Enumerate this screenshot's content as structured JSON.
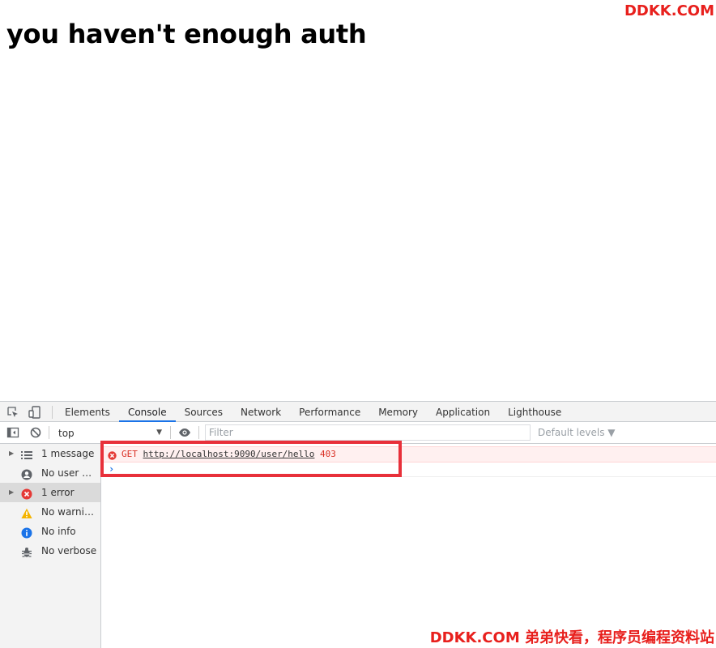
{
  "page": {
    "heading": "you haven't enough auth",
    "watermark_top": "DDKK.COM",
    "watermark_bottom": "DDKK.COM 弟弟快看，程序员编程资料站"
  },
  "devtools": {
    "tabs": [
      {
        "label": "Elements",
        "active": false
      },
      {
        "label": "Console",
        "active": true
      },
      {
        "label": "Sources",
        "active": false
      },
      {
        "label": "Network",
        "active": false
      },
      {
        "label": "Performance",
        "active": false
      },
      {
        "label": "Memory",
        "active": false
      },
      {
        "label": "Application",
        "active": false
      },
      {
        "label": "Lighthouse",
        "active": false
      }
    ],
    "toolbar": {
      "context": "top",
      "filter_placeholder": "Filter",
      "levels": "Default levels ▼"
    },
    "sidebar": {
      "items": [
        {
          "label": "1 message",
          "icon": "list-icon",
          "caret": true,
          "selected": false
        },
        {
          "label": "No user me...",
          "icon": "user-icon",
          "caret": false,
          "selected": false
        },
        {
          "label": "1 error",
          "icon": "error-icon",
          "caret": true,
          "selected": true
        },
        {
          "label": "No warnings",
          "icon": "warning-icon",
          "caret": false,
          "selected": false
        },
        {
          "label": "No info",
          "icon": "info-icon",
          "caret": false,
          "selected": false
        },
        {
          "label": "No verbose",
          "icon": "bug-icon",
          "caret": false,
          "selected": false
        }
      ]
    },
    "console": {
      "error": {
        "method": "GET",
        "url": "http://localhost:9090/user/hello",
        "status": "403"
      }
    }
  },
  "colors": {
    "accent": "#1a73e8",
    "error": "#d93025",
    "highlight_box": "#e8303a",
    "watermark": "#e8201d"
  }
}
